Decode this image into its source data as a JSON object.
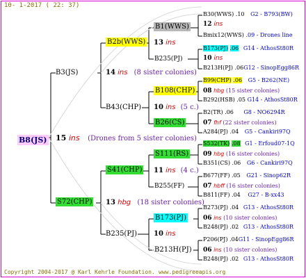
{
  "header": "10-  1-2017 ( 22: 37)",
  "footer": {
    "copyright": "Copyright 2004-2017 @ Karl Kehrle Foundation.",
    "url": "www.pedigreeapis.org"
  },
  "root": {
    "id": "B8(JS)",
    "num": "15",
    "ins": "ins",
    "note": "(Drones from 5 sister colonies)"
  },
  "g1": {
    "sire": {
      "id": "B3(JS)",
      "num": "14",
      "ins": "ins",
      "note": "(8 sister colonies)"
    },
    "dam": {
      "id": "S72(CHP)",
      "num": "13",
      "ins": "hbg",
      "note": "(18 sister colonies)"
    }
  },
  "g2": {
    "ss": {
      "id": "B2b(WWS)",
      "num": "13",
      "ins": "ins"
    },
    "sd": {
      "id": "B43(CHP)",
      "num": "10",
      "ins": "ins",
      "note": "(5 c.)"
    },
    "ds": {
      "id": "S41(CHP)",
      "num": "11",
      "ins": "ins",
      "note": "(4 c.)"
    },
    "dd": {
      "id": "B235(PJ)",
      "num": "10",
      "ins": "ins"
    }
  },
  "g3": {
    "sss": {
      "id": "B1(WWS)",
      "num": "12",
      "ins": "ins"
    },
    "ssd": {
      "id": "B235(PJ)",
      "num": "10",
      "ins": "ins"
    },
    "sds": {
      "id": "B108(CHP)",
      "num": "08",
      "ins": "hbg",
      "note": "(15 sister colonies)"
    },
    "sdd": {
      "id": "B26(CS)",
      "num": "07",
      "ins": "fhf",
      "note": "(22 sister colonies)"
    },
    "dss": {
      "id": "S111(RS)",
      "num": "09",
      "ins": "hbg",
      "note": "(16 sister colonies)"
    },
    "dsd": {
      "id": "B255(FF)",
      "num": "07",
      "ins": "hbff",
      "note": "(16 sister colonies)"
    },
    "dds": {
      "id": "B173(PJ)",
      "num": "06",
      "ins": "ins",
      "note": "(10 sister colonies)"
    },
    "ddd": {
      "id": "B213H(PJ)",
      "num": "06",
      "ins": "ins",
      "note": "(10 sister colonies)"
    }
  },
  "g4": [
    {
      "id": "B30(WWS)",
      "yr": ".10",
      "info": "G2 - B793(BW)"
    },
    {
      "id": "Bmix12(WWS)",
      "yr": ".09",
      "info": "- Drones line"
    },
    {
      "id": "B173(PJ)",
      "yr": ".06",
      "info": "G14 - AthosSt80R"
    },
    {
      "id": "B213H(PJ)",
      "yr": ".06",
      "info": "G12 - SinopEgg86R"
    },
    {
      "id": "B99(CHP)",
      "yr": ".06",
      "info": "G5 - B262(NE)"
    },
    {
      "id": "B292(HSB)",
      "yr": ".05",
      "info": "G14 - AthosSt80R"
    },
    {
      "id": "B2(TR)",
      "yr": ".06",
      "info": "G8 - NO6294R"
    },
    {
      "id": "A284(PJ)",
      "yr": ".04",
      "info": "G5 - Cankiri97Q"
    },
    {
      "id": "S532(TK)",
      "yr": ".08",
      "info": "G1 - Erfoud07-1Q"
    },
    {
      "id": "B351(CS)",
      "yr": ".06",
      "info": "G6 - Cankiri97Q"
    },
    {
      "id": "B677(FF)",
      "yr": ".05",
      "info": "G21 - Sinop62R"
    },
    {
      "id": "B811(FF)",
      "yr": ".04",
      "info": "G27 - B-xx43"
    },
    {
      "id": "B273(PJ)",
      "yr": ".04",
      "info": "G13 - AthosSt80R"
    },
    {
      "id": "B248(PJ)",
      "yr": ".02",
      "info": "G13 - AthosSt80R"
    },
    {
      "id": "P206(PJ)",
      "yr": ".04",
      "info": "G11 - SinopEgg86R"
    },
    {
      "id": "B248(PJ)",
      "yr": ".02",
      "info": "G13 - AthosSt80R"
    }
  ]
}
